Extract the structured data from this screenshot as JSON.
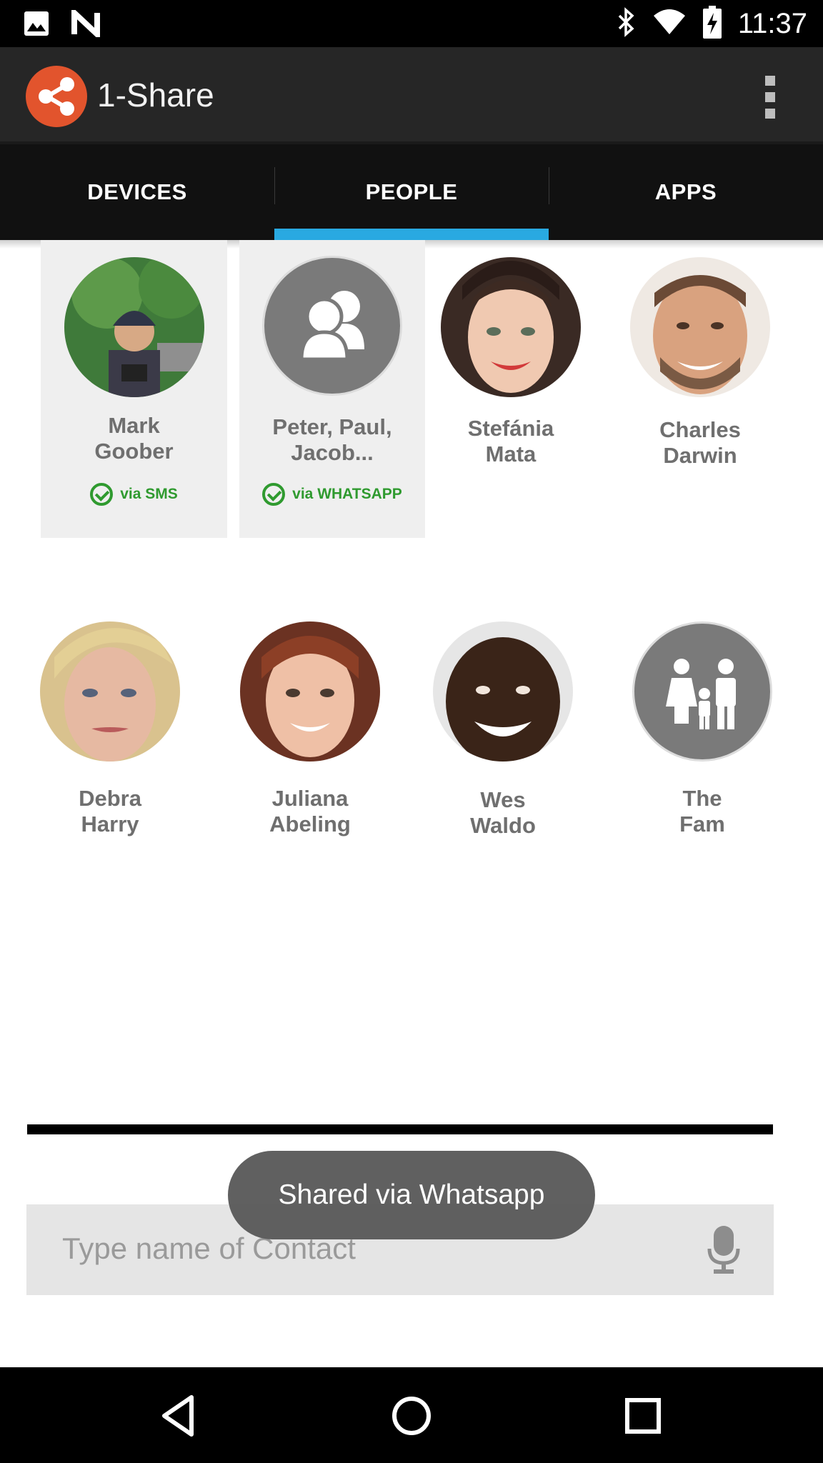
{
  "status_bar": {
    "time": "11:37",
    "left_icons": [
      "image-icon",
      "n-icon"
    ],
    "right_icons": [
      "bluetooth-icon",
      "wifi-icon",
      "battery-charging-icon"
    ]
  },
  "app_bar": {
    "title": "1-Share",
    "logo_icon": "share-icon",
    "menu_icon": "overflow-menu-icon",
    "logo_color": "#e2542d"
  },
  "tabs": [
    {
      "label": "DEVICES",
      "active": false
    },
    {
      "label": "PEOPLE",
      "active": true
    },
    {
      "label": "APPS",
      "active": false
    }
  ],
  "accent_color": "#29a9e1",
  "contacts": [
    {
      "name_line1": "Mark",
      "name_line2": "Goober",
      "shared": true,
      "shared_via": "via SMS",
      "avatar": "photo"
    },
    {
      "name_line1": "Peter, Paul,",
      "name_line2": "Jacob...",
      "shared": true,
      "shared_via": "via WHATSAPP",
      "avatar": "group-icon"
    },
    {
      "name_line1": "Stefánia",
      "name_line2": "Mata",
      "shared": false,
      "avatar": "photo"
    },
    {
      "name_line1": "Charles",
      "name_line2": "Darwin",
      "shared": false,
      "avatar": "photo"
    },
    {
      "name_line1": "Debra",
      "name_line2": "Harry",
      "shared": false,
      "avatar": "photo"
    },
    {
      "name_line1": "Juliana",
      "name_line2": "Abeling",
      "shared": false,
      "avatar": "photo"
    },
    {
      "name_line1": "Wes",
      "name_line2": "Waldo",
      "shared": false,
      "avatar": "photo"
    },
    {
      "name_line1": "The",
      "name_line2": "Fam",
      "shared": false,
      "avatar": "family-icon"
    }
  ],
  "search": {
    "placeholder": "Type name of Contact",
    "value": "",
    "mic_icon": "microphone-icon"
  },
  "toast": {
    "text": "Shared via Whatsapp"
  },
  "nav_bar": {
    "icons": [
      "back-icon",
      "home-icon",
      "recents-icon"
    ]
  }
}
